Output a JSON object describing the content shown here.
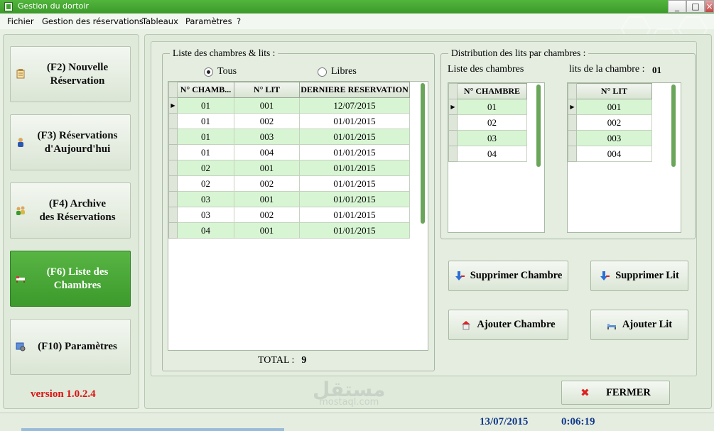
{
  "window": {
    "title": "Gestion du dortoir"
  },
  "menu": [
    "Fichier",
    "Gestion des réservations",
    "Tableaux",
    "Paramètres",
    "?"
  ],
  "sidebar": {
    "buttons": [
      {
        "line1": "(F2) Nouvelle",
        "line2": "Réservation",
        "icon": "form-icon"
      },
      {
        "line1": "(F3) Réservations",
        "line2": "d'Aujourd'hui",
        "icon": "person-icon"
      },
      {
        "line1": "(F4) Archive",
        "line2": "des Réservations",
        "icon": "people-icon"
      },
      {
        "line1": "(F6) Liste des",
        "line2": "Chambres",
        "icon": "bed-icon"
      },
      {
        "line1": "(F10) Paramètres",
        "line2": "",
        "icon": "settings-icon"
      }
    ],
    "version": "version 1.0.2.4"
  },
  "rooms_beds": {
    "title": "Liste des chambres & lits :",
    "filter": {
      "all": "Tous",
      "free": "Libres",
      "selected": "Tous"
    },
    "columns": [
      "N° CHAMB...",
      "N° LIT",
      "DERNIERE RESERVATION"
    ],
    "rows": [
      [
        "01",
        "001",
        "12/07/2015"
      ],
      [
        "01",
        "002",
        "01/01/2015"
      ],
      [
        "01",
        "003",
        "01/01/2015"
      ],
      [
        "01",
        "004",
        "01/01/2015"
      ],
      [
        "02",
        "001",
        "01/01/2015"
      ],
      [
        "02",
        "002",
        "01/01/2015"
      ],
      [
        "03",
        "001",
        "01/01/2015"
      ],
      [
        "03",
        "002",
        "01/01/2015"
      ],
      [
        "04",
        "001",
        "01/01/2015"
      ]
    ],
    "total_label": "TOTAL :",
    "total_value": "9"
  },
  "distribution": {
    "title": "Distribution des lits par chambres :",
    "rooms_label": "Liste des chambres",
    "beds_label": "lits de la chambre :",
    "selected_room": "01",
    "rooms_column": "N° CHAMBRE",
    "rooms": [
      "01",
      "02",
      "03",
      "04"
    ],
    "beds_column": "N° LIT",
    "beds": [
      "001",
      "002",
      "003",
      "004"
    ]
  },
  "actions": {
    "delete_room": "Supprimer Chambre",
    "delete_bed": "Supprimer Lit",
    "add_room": "Ajouter Chambre",
    "add_bed": "Ajouter Lit",
    "close": "FERMER"
  },
  "status": {
    "date": "13/07/2015",
    "time": "0:06:19"
  },
  "watermark": {
    "arabic": "مستقل",
    "latin": "mostaql.com"
  },
  "colors": {
    "accent": "#3fa52e",
    "row_highlight": "#d7f5d3",
    "version": "#dd1111",
    "status_text": "#123a8a"
  }
}
